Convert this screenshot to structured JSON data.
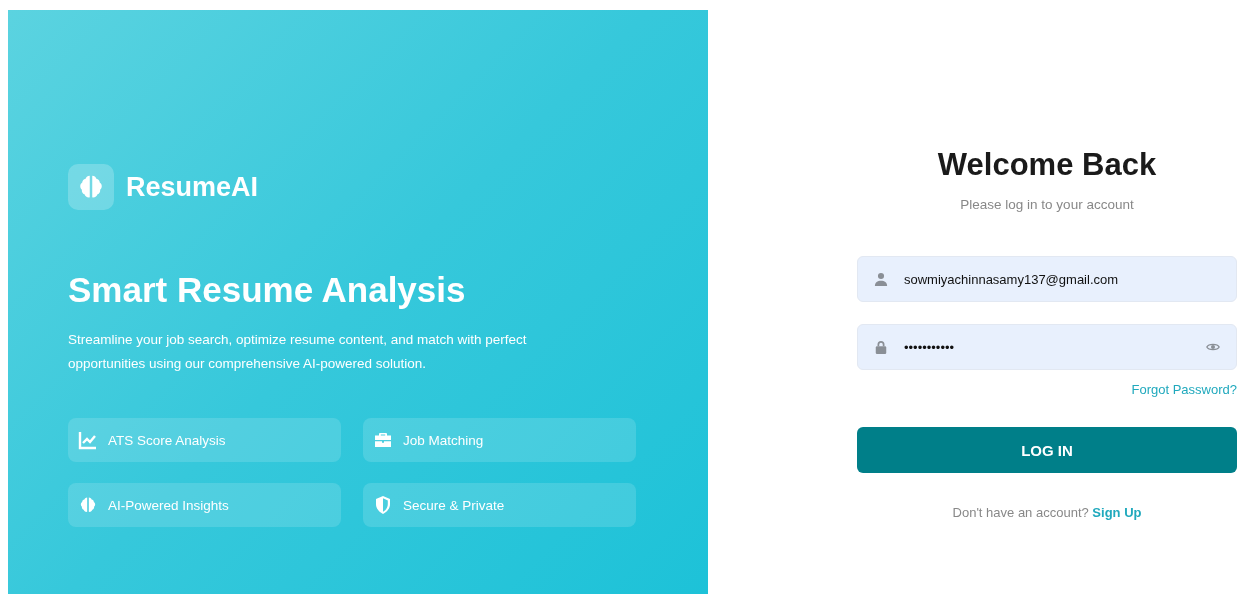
{
  "brand": {
    "name": "ResumeAI"
  },
  "hero": {
    "title": "Smart Resume Analysis",
    "description": "Streamline your job search, optimize resume content, and match with perfect opportunities using our comprehensive AI-powered solution."
  },
  "features": [
    {
      "kind": "chart",
      "label": "ATS Score Analysis"
    },
    {
      "kind": "briefcase",
      "label": "Job Matching"
    },
    {
      "kind": "brain",
      "label": "AI-Powered Insights"
    },
    {
      "kind": "shield",
      "label": "Secure & Private"
    }
  ],
  "login": {
    "title": "Welcome Back",
    "subtitle": "Please log in to your account",
    "fields": [
      {
        "kind": "email",
        "value": "sowmiyachinnasamy137@gmail.com"
      },
      {
        "kind": "password",
        "value": "•••••••••••"
      }
    ],
    "forgot_link": "Forgot Password?",
    "button": "LOG IN",
    "signup_prompt": "Don't have an account?",
    "signup_link": "Sign Up"
  }
}
